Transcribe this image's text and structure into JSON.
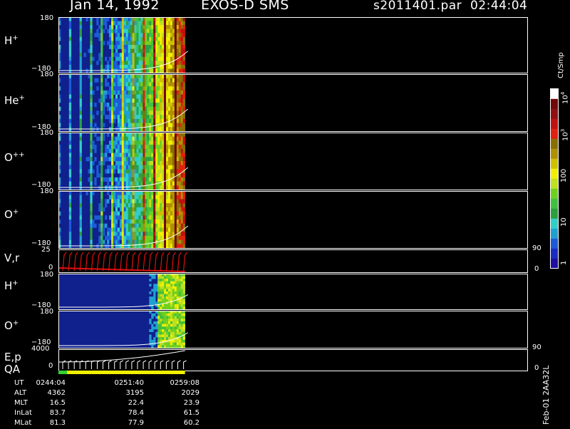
{
  "header": {
    "date": "Jan 14, 1992",
    "instrument": "EXOS-D SMS",
    "file": "s2011401.par",
    "time": "02:44:04"
  },
  "colors": {
    "background": "#000000",
    "frame": "#ffffff",
    "fill_dark": "#10208c",
    "colorbar": [
      "#1e0fa0",
      "#1a2cc0",
      "#1c5ad8",
      "#20a0d0",
      "#30d0c8",
      "#2aa040",
      "#40c040",
      "#70d020",
      "#c0e020",
      "#f0f000",
      "#d0c000",
      "#b09000",
      "#887000",
      "#e02010",
      "#c01010",
      "#901010",
      "#700808",
      "#ffffff"
    ]
  },
  "colorbar": {
    "unit": "Ct/Smp",
    "ticks": [
      "1",
      "10",
      "100",
      "10",
      "10"
    ],
    "tick_powers": [
      "",
      "",
      "",
      "3",
      "4"
    ]
  },
  "panels": [
    {
      "label": "H",
      "sup": "+",
      "ymax": "180",
      "ymin": "−180"
    },
    {
      "label": "He",
      "sup": "+",
      "ymax": "180",
      "ymin": "−180"
    },
    {
      "label": "O",
      "sup": "++",
      "ymax": "180",
      "ymin": "−180"
    },
    {
      "label": "O",
      "sup": "+",
      "ymax": "180",
      "ymin": "−180"
    },
    {
      "label": "V,r",
      "sup": "",
      "ymax": "25",
      "ymin": "0",
      "right_max": "90",
      "right_min": "0"
    },
    {
      "label": "H",
      "sup": "+",
      "ymax": "180",
      "ymin": "−180"
    },
    {
      "label": "O",
      "sup": "+",
      "ymax": "180",
      "ymin": "−180"
    },
    {
      "label": "E,p",
      "sup": "",
      "ymax": "4000",
      "ymin": "0",
      "right_max": "90",
      "right_min": "0"
    }
  ],
  "qa_label": "QA",
  "orbit_table": {
    "rows": [
      {
        "label": "UT",
        "values": [
          "0244:04",
          "0251:40",
          "0259:08"
        ]
      },
      {
        "label": "ALT",
        "values": [
          "4362",
          "3195",
          "2029"
        ]
      },
      {
        "label": "MLT",
        "values": [
          "16.5",
          "22.4",
          "23.9"
        ]
      },
      {
        "label": "InLat",
        "values": [
          "83.7",
          "78.4",
          "61.5"
        ]
      },
      {
        "label": "MLat",
        "values": [
          "81.3",
          "77.9",
          "60.2"
        ]
      }
    ]
  },
  "footer_version": "Feb-01 2AA32L",
  "chart_data": {
    "type": "heatmap",
    "title": "Jan 14, 1992   EXOS-D SMS",
    "xlabel": "UT",
    "x_ticks": [
      "0244:04",
      "0251:40",
      "0259:08"
    ],
    "data_extent_fraction": 0.27,
    "series": [
      {
        "name": "H+",
        "ylim": [
          -180,
          180
        ]
      },
      {
        "name": "He+",
        "ylim": [
          -180,
          180
        ]
      },
      {
        "name": "O++",
        "ylim": [
          -180,
          180
        ]
      },
      {
        "name": "O+",
        "ylim": [
          -180,
          180
        ]
      },
      {
        "name": "V,r",
        "ylim": [
          0,
          25
        ],
        "y2lim": [
          0,
          90
        ]
      },
      {
        "name": "H+",
        "ylim": [
          -180,
          180
        ]
      },
      {
        "name": "O+",
        "ylim": [
          -180,
          180
        ]
      },
      {
        "name": "E,p",
        "ylim": [
          0,
          4000
        ],
        "y2lim": [
          0,
          90
        ]
      }
    ],
    "colorbar_scale": "log",
    "colorbar_range": [
      1,
      10000
    ]
  }
}
